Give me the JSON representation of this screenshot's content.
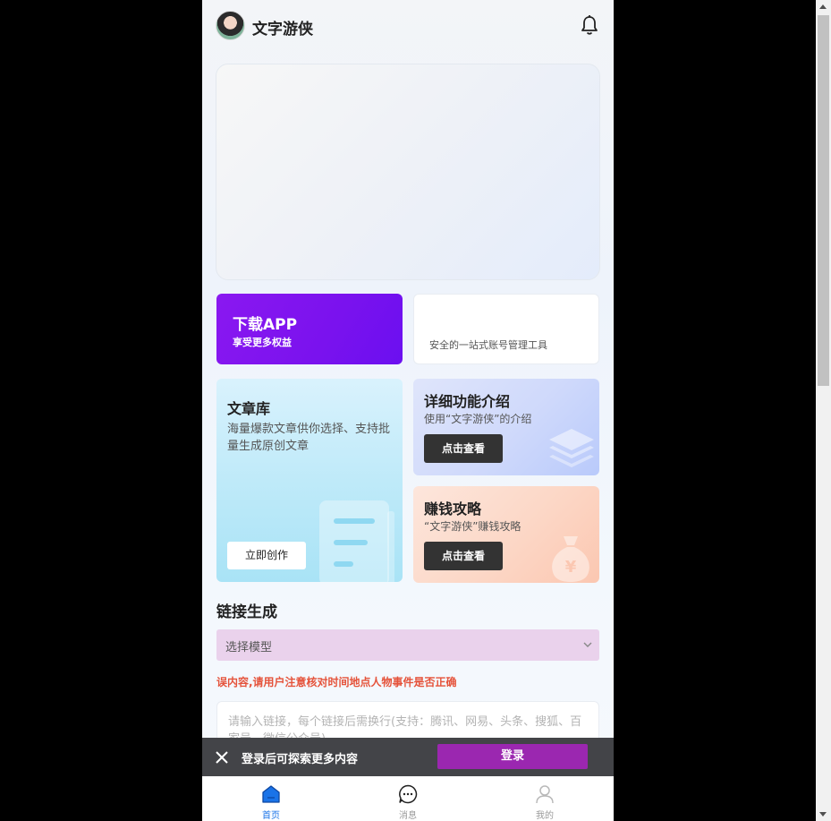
{
  "header": {
    "title": "文字游侠"
  },
  "download_card": {
    "title": "下载APP",
    "subtitle": "享受更多权益"
  },
  "tool_card": {
    "subtitle": "安全的一站式账号管理工具"
  },
  "library_card": {
    "title": "文章库",
    "description": "海量爆款文章供你选择、支持批量生成原创文章",
    "button": "立即创作"
  },
  "feature_card": {
    "title": "详细功能介绍",
    "subtitle": "使用“文字游侠”的介绍",
    "button": "点击查看"
  },
  "earn_card": {
    "title": "赚钱攻略",
    "subtitle": "“文字游侠”赚钱攻略",
    "button": "点击查看"
  },
  "link_section": {
    "title": "链接生成",
    "select_value": "选择模型",
    "warning": "误内容,请用户注意核对时间地点人物事件是否正确",
    "textarea_placeholder": "请输入链接，每个链接后需换行(支持：腾讯、网易、头条、搜狐、百家号、微信公众号)"
  },
  "login_bar": {
    "hint": "登录后可探索更多内容",
    "button": "登录"
  },
  "tabs": [
    {
      "label": "首页",
      "icon": "home-icon",
      "active": true
    },
    {
      "label": "消息",
      "icon": "message-icon",
      "active": false
    },
    {
      "label": "我的",
      "icon": "user-icon",
      "active": false
    }
  ],
  "colors": {
    "accent_purple": "#7a12ee",
    "login_button": "#9b27b0",
    "warning": "#e5533b",
    "active_tab": "#1a73e8"
  }
}
